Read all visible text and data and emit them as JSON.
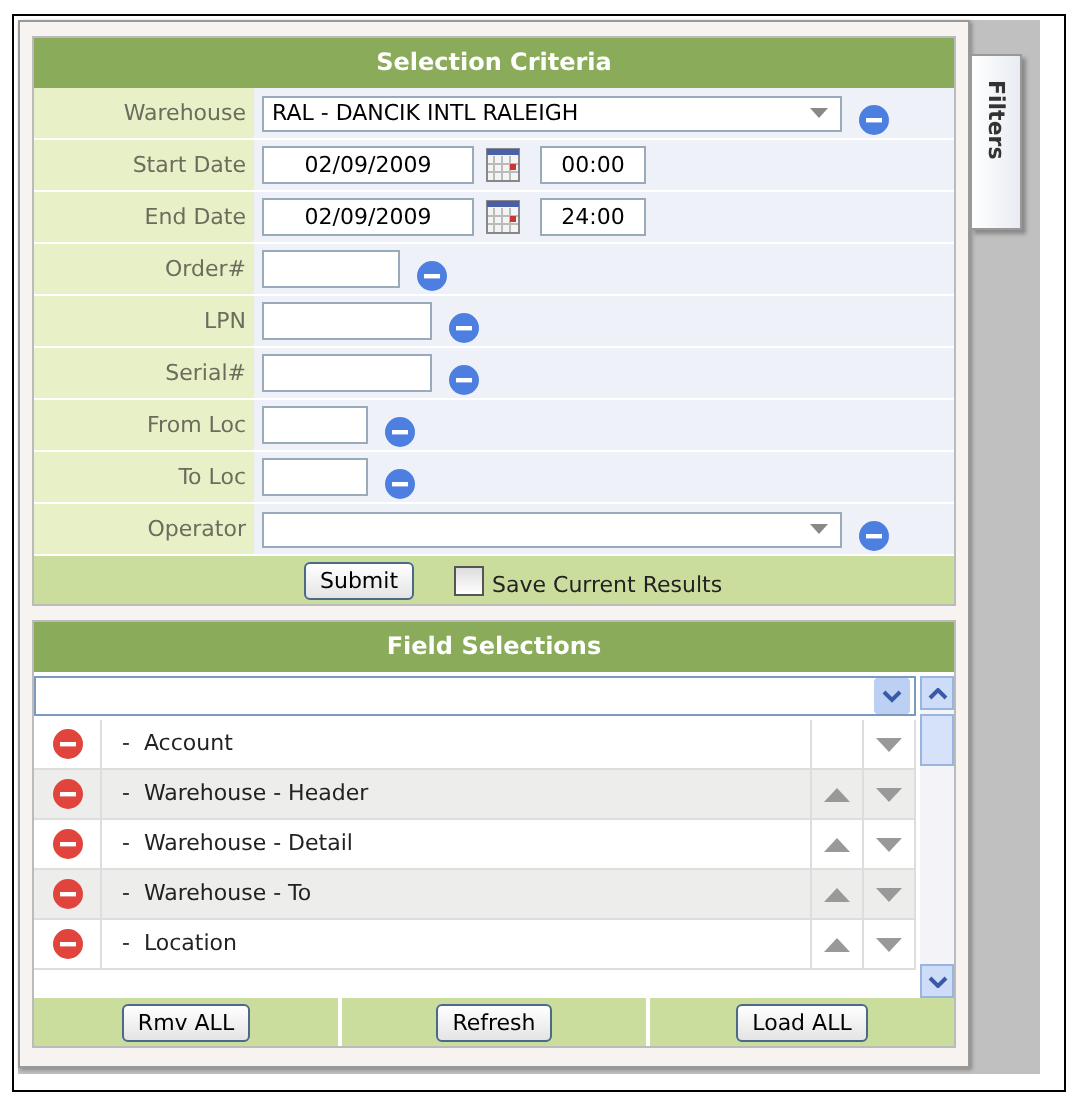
{
  "criteria": {
    "title": "Selection Criteria",
    "rows": [
      {
        "kind": "select",
        "label": "Warehouse",
        "value": "RAL - DANCIK INTL RALEIGH",
        "removable": true
      },
      {
        "kind": "date",
        "label": "Start Date",
        "value": "02/09/2009",
        "time": "00:00"
      },
      {
        "kind": "date",
        "label": "End Date",
        "value": "02/09/2009",
        "time": "24:00"
      },
      {
        "kind": "text",
        "label": "Order#",
        "value": "",
        "removable": true
      },
      {
        "kind": "text",
        "label": "LPN",
        "value": "",
        "removable": true
      },
      {
        "kind": "text",
        "label": "Serial#",
        "value": "",
        "removable": true
      },
      {
        "kind": "text",
        "label": "From Loc",
        "value": "",
        "removable": true
      },
      {
        "kind": "text",
        "label": "To Loc",
        "value": "",
        "removable": true
      },
      {
        "kind": "select",
        "label": "Operator",
        "value": "",
        "removable": true
      }
    ],
    "submit": "Submit",
    "save_results": {
      "label": "Save Current Results",
      "checked": false
    }
  },
  "fields": {
    "title": "Field Selections",
    "items": [
      {
        "label": "-  Account",
        "can_move_up": false
      },
      {
        "label": "-  Warehouse - Header",
        "can_move_up": true
      },
      {
        "label": "-  Warehouse - Detail",
        "can_move_up": true
      },
      {
        "label": "-  Warehouse - To",
        "can_move_up": true
      },
      {
        "label": "-  Location",
        "can_move_up": true
      }
    ],
    "buttons": [
      "Rmv ALL",
      "Refresh",
      "Load ALL"
    ]
  },
  "side_tab": "Filters"
}
